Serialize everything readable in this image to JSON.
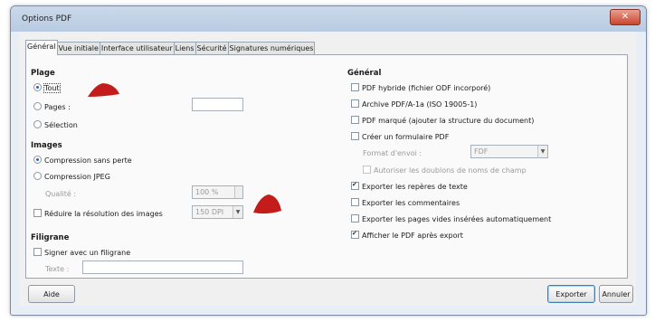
{
  "window": {
    "title": "Options PDF",
    "close_icon": "✕"
  },
  "tabs": [
    "Général",
    "Vue initiale",
    "Interface utilisateur",
    "Liens",
    "Sécurité",
    "Signatures numériques"
  ],
  "left": {
    "plage": {
      "heading": "Plage",
      "tout": "Tout",
      "pages": "Pages :",
      "pages_value": "",
      "selection": "Sélection"
    },
    "images": {
      "heading": "Images",
      "compression_sans_perte": "Compression sans perte",
      "compression_jpeg": "Compression JPEG",
      "qualite_label": "Qualité :",
      "qualite_value": "100 %",
      "reduire_label": "Réduire la résolution des images",
      "reduire_value": "150 DPI"
    },
    "filigrane": {
      "heading": "Filigrane",
      "signer": "Signer avec un filigrane",
      "texte_label": "Texte :",
      "texte_value": ""
    }
  },
  "right": {
    "heading": "Général",
    "pdf_hybride": "PDF hybride (fichier ODF incorporé)",
    "archive": "Archive PDF/A-1a (ISO 19005-1)",
    "pdf_marque": "PDF marqué (ajouter la structure du document)",
    "creer_formulaire": "Créer un formulaire PDF",
    "format_envoi_label": "Format d'envoi :",
    "format_envoi_value": "FDF",
    "autoriser_doublons": "Autoriser les doublons de noms de champ",
    "exporter_reperes": "Exporter les repères de texte",
    "exporter_commentaires": "Exporter les commentaires",
    "exporter_pages_vides": "Exporter les pages vides insérées automatiquement",
    "afficher_pdf": "Afficher le PDF après export"
  },
  "buttons": {
    "aide": "Aide",
    "exporter": "Exporter",
    "annuler": "Annuler"
  },
  "colors": {
    "annotation_marker": "#c41b1b"
  }
}
